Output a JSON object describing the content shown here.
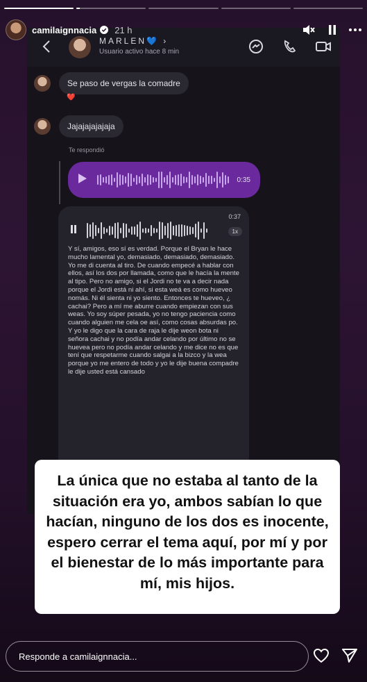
{
  "story": {
    "progress": [
      1,
      0.05,
      0,
      0,
      0
    ]
  },
  "header": {
    "username": "camilaignnacia",
    "time": "21 h"
  },
  "screenshot": {
    "contact_name": "MARLEN💙 ›",
    "contact_status": "Usuario activo hace 8 min",
    "messages": [
      {
        "text": "Se paso de vergas la comadre",
        "reaction": "❤️"
      },
      {
        "text": "Jajajajajajaja"
      }
    ],
    "replied_label": "Te respondió",
    "voice_duration": "0:35",
    "transcription": {
      "duration": "0:37",
      "speed": "1x",
      "text": "Y sí, amigos, eso sí es verdad. Porque el Bryan le hace mucho lamental yo, demasiado, demasiado, demasiado. Yo me di cuenta al tiro. De cuando empecé a hablar con ellos, así los dos por llamada, como que le hacía la mente al tipo. Pero no amigo, si el Jordi no te va a decir nada porque el Jordi está ni ahí, si esta weá es como hueveo nomás. Ni él sienta ni yo siento. Entonces te hueveo, ¿ cachai? Pero a mí me aburre cuando empiezan con sus weas. Yo soy súper pesada, yo no tengo paciencia como cuando alguien me cela oe así, como cosas absurdas po. Y yo le digo que la cara de raja le dije weon bota ni señora cachai y no podía andar celando por último no se huevea pero no podía andar celando y me dice no es que tení que respetarme cuando salgai a la bizco y la wea porque yo me entero de todo y yo le dije buena compadre le dije usted está cansado"
    }
  },
  "caption": "La única que no estaba al tanto de la situación era yo, ambos sabían lo que hacían, ninguno de los dos es inocente, espero cerrar el tema aquí, por mí y por el bienestar de lo más importante para mí, mis hijos.",
  "reply": {
    "placeholder": "Responde a camilaignnacia..."
  },
  "colors": {
    "background": "#2d1434",
    "voice_bubble": "#6a2a9e",
    "caption_bg": "#ffffff"
  },
  "icons": [
    "verified-icon",
    "mute-icon",
    "pause-icon",
    "more-icon",
    "back-icon",
    "messenger-icon",
    "phone-icon",
    "video-icon",
    "play-icon",
    "heart-icon",
    "send-icon"
  ]
}
